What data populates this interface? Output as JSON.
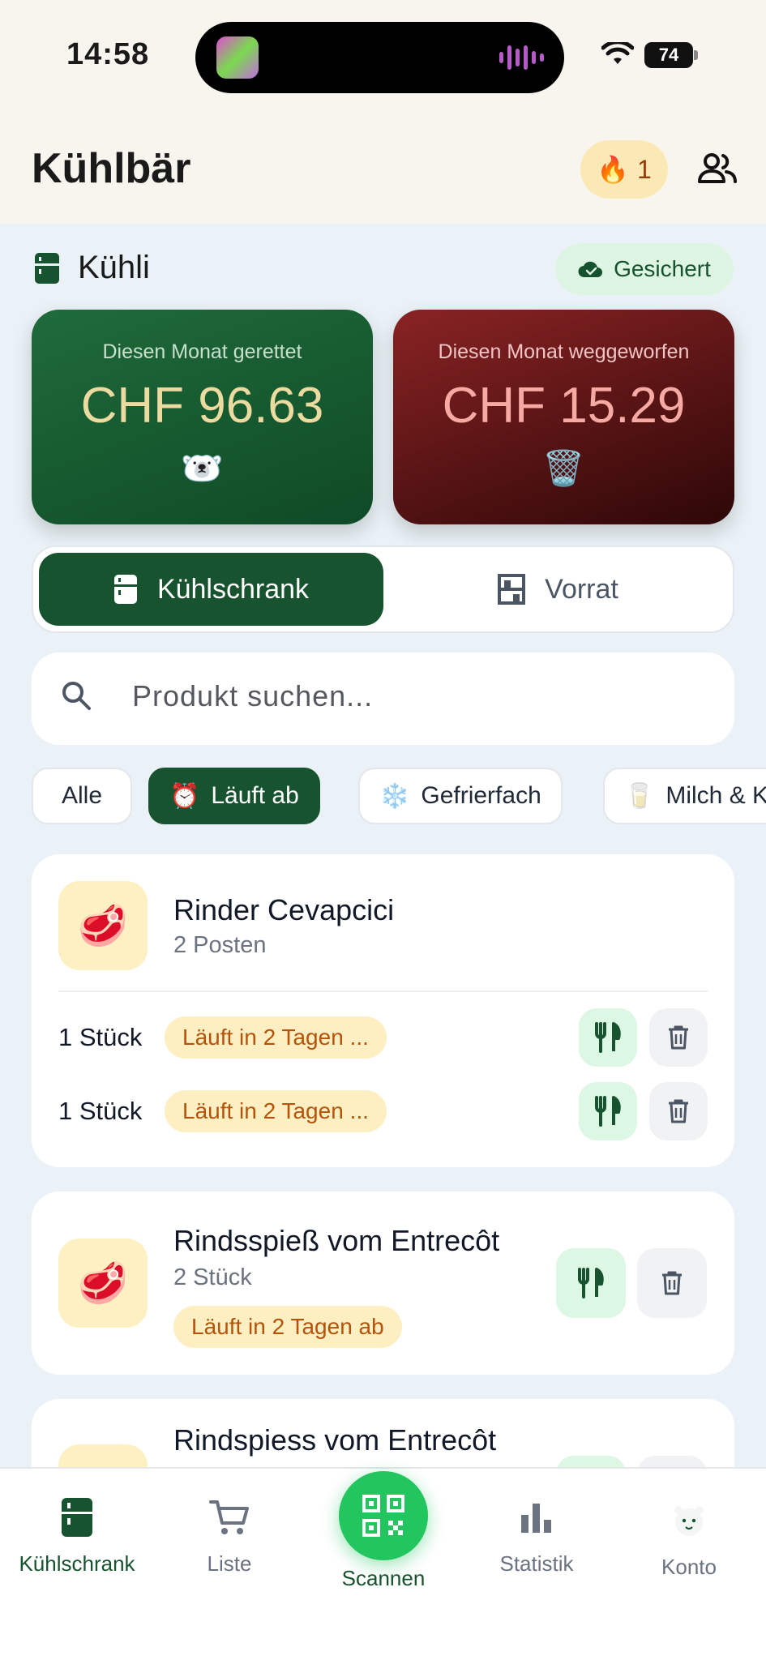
{
  "status_bar": {
    "time": "14:58",
    "battery": "74"
  },
  "header": {
    "title": "Kühlbär",
    "streak_count": "1",
    "streak_icon": "🔥"
  },
  "section": {
    "title": "Kühli",
    "saved_badge": "Gesichert"
  },
  "stats": {
    "saved": {
      "label": "Diesen Monat gerettet",
      "amount": "CHF 96.63",
      "emoji": "🐻‍❄️"
    },
    "wasted": {
      "label": "Diesen Monat weggeworfen",
      "amount": "CHF 15.29",
      "emoji": "🗑️"
    }
  },
  "segment": {
    "active": "Kühlschrank",
    "inactive": "Vorrat"
  },
  "search": {
    "placeholder": "Produkt suchen..."
  },
  "filters": [
    {
      "label": "Alle",
      "icon": ""
    },
    {
      "label": "Läuft ab",
      "icon": "⏰"
    },
    {
      "label": "Gefrierfach",
      "icon": "❄️"
    },
    {
      "label": "Milch & Käse",
      "icon": "🥛"
    }
  ],
  "products": [
    {
      "name": "Rinder Cevapcici",
      "sub": "2 Posten",
      "emoji": "🥩",
      "entries": [
        {
          "qty": "1 Stück",
          "expiry": "Läuft in 2 Tagen ..."
        },
        {
          "qty": "1 Stück",
          "expiry": "Läuft in 2 Tagen ..."
        }
      ]
    },
    {
      "name": "Rindsspieß vom Entrecôt",
      "sub": "2 Stück",
      "emoji": "🥩",
      "expiry": "Läuft in 2 Tagen ab"
    },
    {
      "name": "Rindspiess vom Entrecôt",
      "emoji": "🥩"
    }
  ],
  "nav": {
    "fridge": "Kühlschrank",
    "list": "Liste",
    "scan": "Scannen",
    "stats": "Statistik",
    "account": "Konto"
  },
  "colors": {
    "primary": "#17532e",
    "accent_green": "#22c55e",
    "saved_card": "#1f6b3b",
    "waste_card": "#8a2324",
    "expiry_text": "#b45309"
  }
}
